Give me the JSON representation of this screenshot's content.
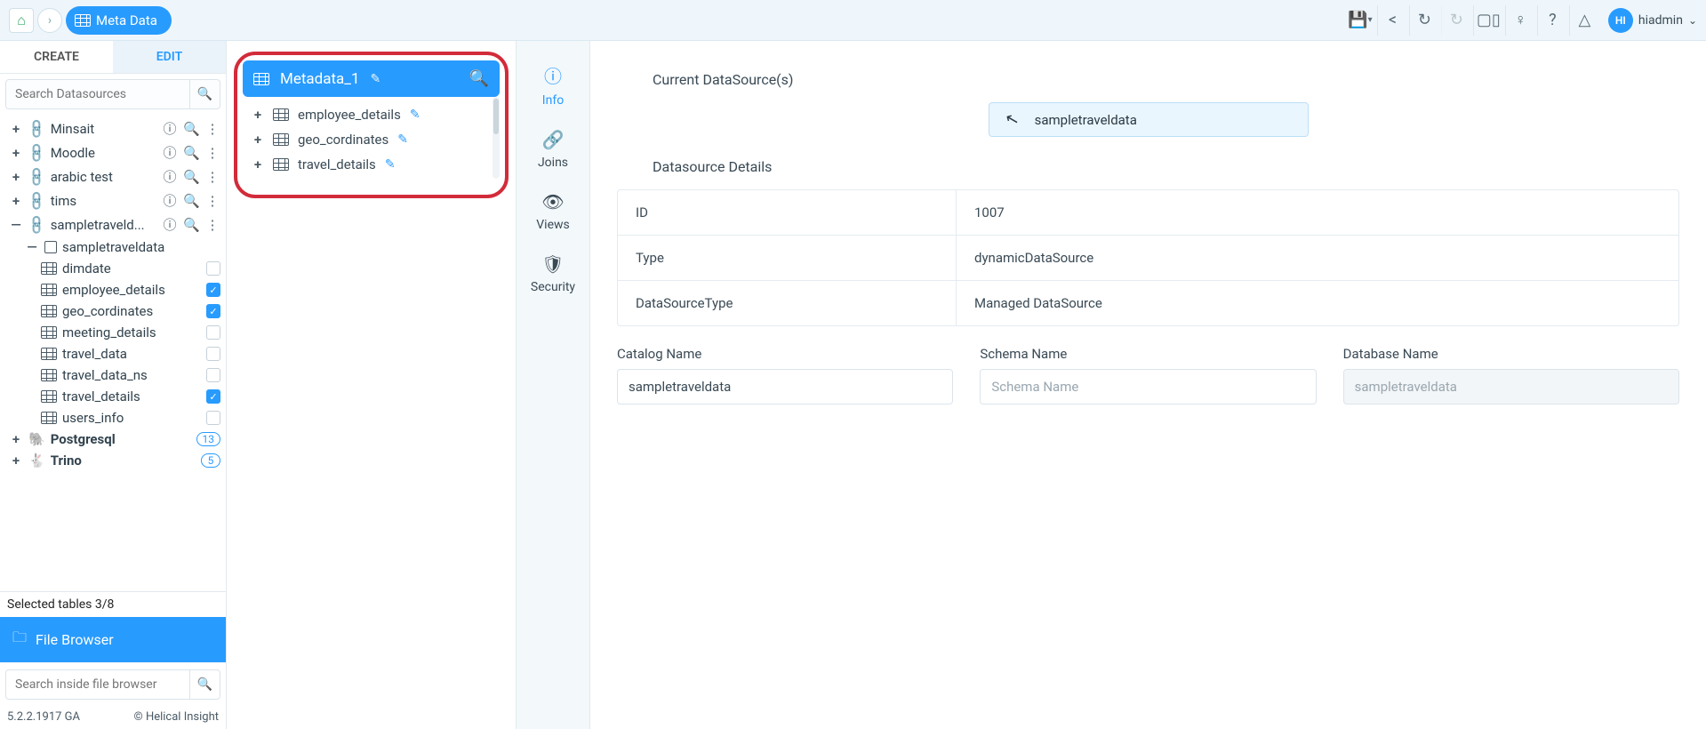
{
  "breadcrumb": {
    "page_label": "Meta Data"
  },
  "user": {
    "initials": "HI",
    "name": "hiadmin"
  },
  "tabs": {
    "create": "CREATE",
    "edit": "EDIT"
  },
  "search": {
    "datasource_placeholder": "Search Datasources",
    "files_placeholder": "Search inside file browser"
  },
  "datasources": {
    "items": [
      {
        "name": "Minsait",
        "expanded": false
      },
      {
        "name": "Moodle",
        "expanded": false
      },
      {
        "name": "arabic test",
        "expanded": false
      },
      {
        "name": "tims",
        "expanded": false
      }
    ],
    "open_ds": {
      "name": "sampletraveld...",
      "schema": "sampletraveldata",
      "tables": [
        {
          "name": "dimdate",
          "checked": false
        },
        {
          "name": "employee_details",
          "checked": true
        },
        {
          "name": "geo_cordinates",
          "checked": true
        },
        {
          "name": "meeting_details",
          "checked": false
        },
        {
          "name": "travel_data",
          "checked": false
        },
        {
          "name": "travel_data_ns",
          "checked": false
        },
        {
          "name": "travel_details",
          "checked": true
        },
        {
          "name": "users_info",
          "checked": false
        }
      ]
    },
    "others": [
      {
        "name": "Postgresql",
        "badge": "13"
      },
      {
        "name": "Trino",
        "badge": "5"
      }
    ]
  },
  "selection_summary": "Selected tables 3/8",
  "file_browser_label": "File Browser",
  "footer": {
    "version": "5.2.2.1917 GA",
    "copy": "© Helical Insight"
  },
  "metadata_panel": {
    "title": "Metadata_1",
    "tables": [
      "employee_details",
      "geo_cordinates",
      "travel_details"
    ]
  },
  "vnav": {
    "info": "Info",
    "joins": "Joins",
    "views": "Views",
    "security": "Security"
  },
  "current_ds": {
    "label": "Current DataSource(s)",
    "name": "sampletraveldata"
  },
  "details": {
    "label": "Datasource Details",
    "rows": [
      {
        "key": "ID",
        "val": "1007"
      },
      {
        "key": "Type",
        "val": "dynamicDataSource"
      },
      {
        "key": "DataSourceType",
        "val": "Managed DataSource"
      }
    ],
    "catalog": {
      "label": "Catalog Name",
      "value": "sampletraveldata"
    },
    "schema": {
      "label": "Schema Name",
      "placeholder": "Schema Name"
    },
    "database": {
      "label": "Database Name",
      "value": "sampletraveldata"
    }
  }
}
